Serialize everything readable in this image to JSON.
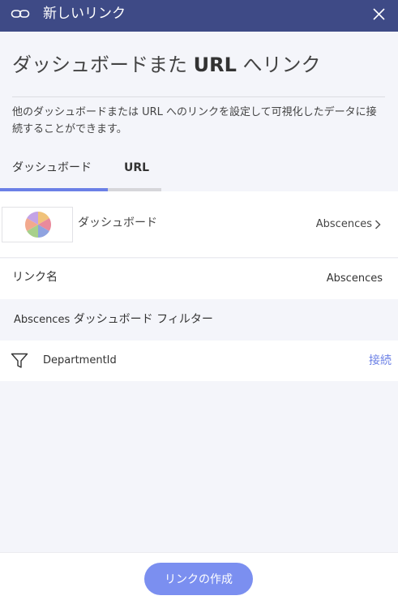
{
  "titlebar": {
    "title": "新しいリンク"
  },
  "heading": {
    "prefix": "ダッシュボードまた ",
    "url": "URL",
    "suffix": " へリンク"
  },
  "description": "他のダッシュボードまたは URL へのリンクを設定して可視化したデータに接続することができます。",
  "tabs": [
    {
      "label": "ダッシュボード",
      "active": true
    },
    {
      "label": "URL",
      "active": false
    }
  ],
  "dashboard_row": {
    "label": "ダッシュボード",
    "value": "Abscences",
    "thumbnail_colors": [
      "#f0c27a",
      "#e98a9c",
      "#8fa3e0",
      "#a7d08b",
      "#f2a98e",
      "#c4a3e6"
    ]
  },
  "link_name": {
    "label": "リンク名",
    "value": "Abscences"
  },
  "filter_section": {
    "dashboard": "Abscences",
    "title": "ダッシュボード フィルター"
  },
  "filters": [
    {
      "name": "DepartmentId",
      "action": "接続"
    }
  ],
  "footer": {
    "create_label": "リンクの作成"
  },
  "colors": {
    "titlebar": "#3e4a86",
    "accent": "#6b80e6",
    "button": "#7b8ff0",
    "background": "#f4f5fa"
  }
}
